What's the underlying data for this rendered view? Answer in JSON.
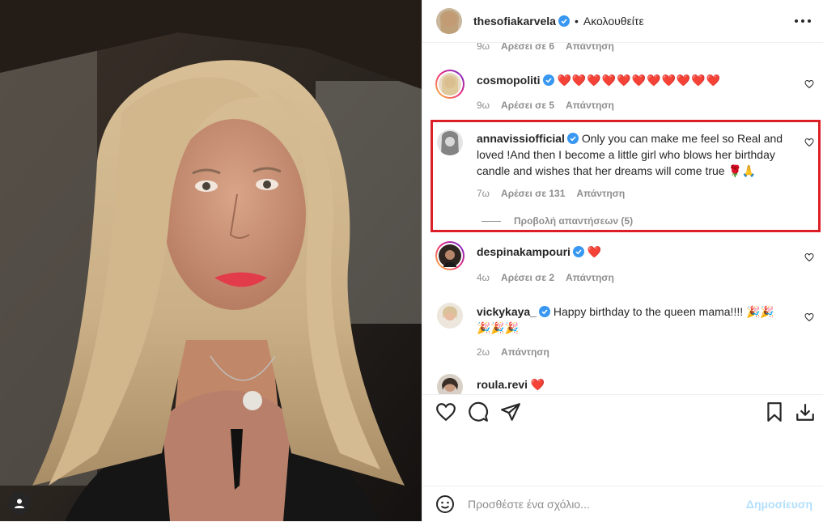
{
  "post": {
    "author": "thesofiakarvela",
    "follow_status": "Ακολουθείτε",
    "separator": "•",
    "more": "•••"
  },
  "comments": [
    {
      "user": "",
      "text": "",
      "meta_time": "9ω",
      "meta_likes": "Αρέσει σε 6",
      "meta_reply": "Απάντηση",
      "partial": true
    },
    {
      "user": "cosmopoliti",
      "text": "❤️❤️❤️❤️❤️❤️❤️❤️❤️❤️❤️",
      "meta_time": "9ω",
      "meta_likes": "Αρέσει σε 5",
      "meta_reply": "Απάντηση"
    },
    {
      "user": "annavissiofficial",
      "text": "Only you can make me feel so Real and loved !And then I become a little girl who blows her birthday candle and wishes that her dreams will come true 🌹🙏",
      "meta_time": "7ω",
      "meta_likes": "Αρέσει σε 131",
      "meta_reply": "Απάντηση",
      "replies": "Προβολή απαντήσεων (5)"
    },
    {
      "user": "despinakampouri",
      "text": "❤️",
      "meta_time": "4ω",
      "meta_likes": "Αρέσει σε 2",
      "meta_reply": "Απάντηση"
    },
    {
      "user": "vickykaya_",
      "text": "Happy birthday to the queen mama!!!! 🎉🎉🎉🎉🎉",
      "meta_time": "2ω",
      "meta_reply": "Απάντηση"
    },
    {
      "user": "roula.revi",
      "text": "❤️",
      "partial": true
    }
  ],
  "add_comment": {
    "placeholder": "Προσθέστε ένα σχόλιο...",
    "post_label": "Δημοσίευση"
  },
  "colors": {
    "highlight": "#dc1f26",
    "verified": "#3897f0",
    "heart": "#ed1c24"
  }
}
